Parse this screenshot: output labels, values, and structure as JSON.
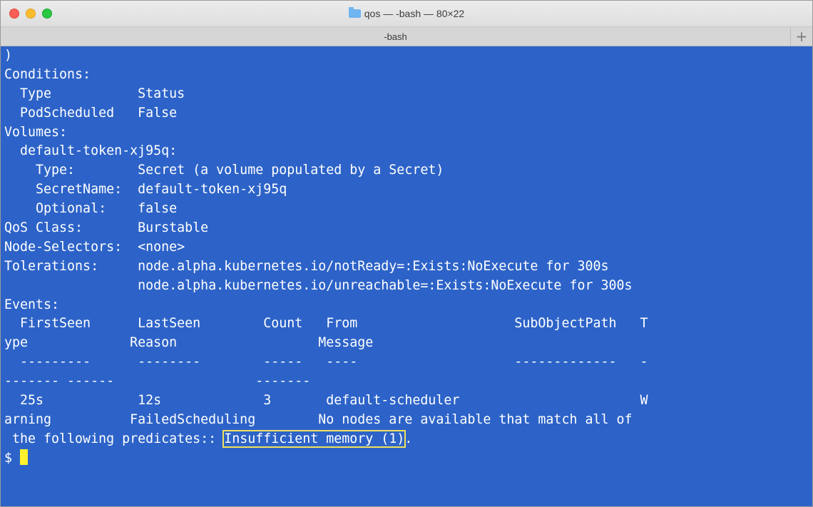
{
  "window": {
    "title": "qos — -bash — 80×22",
    "folder_icon": "folder-icon"
  },
  "tabs": [
    {
      "label": "-bash"
    }
  ],
  "new_tab_label": "+",
  "colors": {
    "terminal_bg": "#2d63c8",
    "text": "#ffffff",
    "highlight_box": "#f1e15b",
    "cursor": "#fff12e"
  },
  "terminal": {
    "lines": [
      ")",
      "Conditions:",
      "  Type           Status",
      "  PodScheduled   False",
      "Volumes:",
      "  default-token-xj95q:",
      "    Type:        Secret (a volume populated by a Secret)",
      "    SecretName:  default-token-xj95q",
      "    Optional:    false",
      "QoS Class:       Burstable",
      "Node-Selectors:  <none>",
      "Tolerations:     node.alpha.kubernetes.io/notReady=:Exists:NoExecute for 300s",
      "                 node.alpha.kubernetes.io/unreachable=:Exists:NoExecute for 300s",
      "Events:",
      "  FirstSeen      LastSeen        Count   From                    SubObjectPath   T",
      "ype             Reason                  Message",
      "  ---------      --------        -----   ----                    -------------   -",
      "------- ------                  -------",
      "  25s            12s             3       default-scheduler                       W",
      "arning          FailedScheduling        No nodes are available that match all of"
    ],
    "last_line": {
      "prefix": " the following predicates:: ",
      "highlight": "Insufficient memory (1)",
      "suffix": "."
    },
    "prompt": "$ "
  }
}
